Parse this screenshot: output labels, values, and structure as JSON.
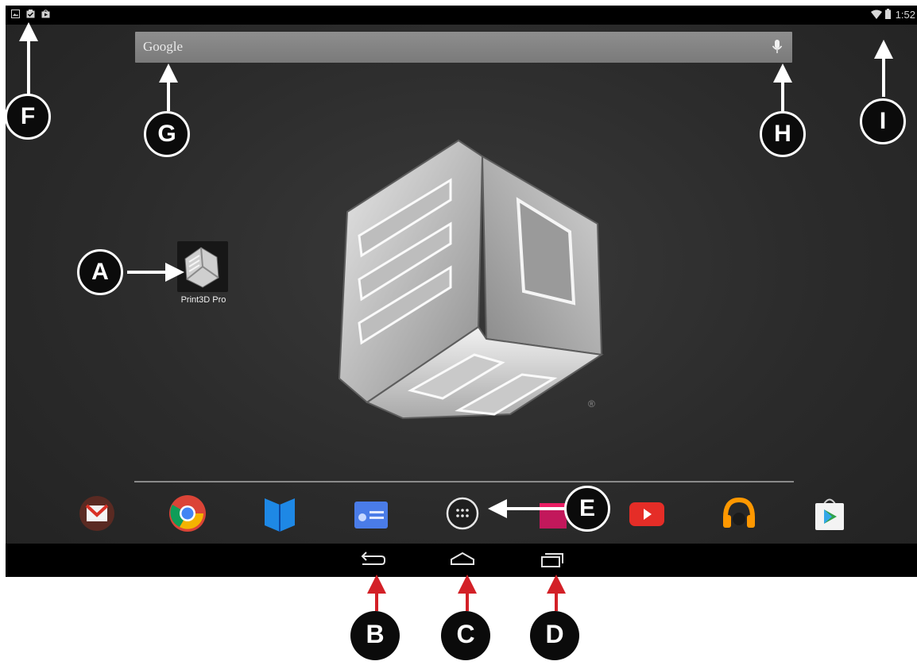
{
  "status_bar": {
    "left_icons": [
      "gallery-icon",
      "clipboard-check-icon",
      "play-store-bag-icon"
    ],
    "right_icons": [
      "wifi-icon",
      "battery-icon"
    ],
    "time": "1:52"
  },
  "search_bar": {
    "text": "Google",
    "mic_icon": "microphone-icon"
  },
  "home_shortcut": {
    "label": "Print3D Pro",
    "icon": "print3d-cube-icon"
  },
  "wallpaper": {
    "logo": "3d-systems-cube-logo",
    "registered_mark": "®"
  },
  "dock": {
    "apps": [
      {
        "name": "Gmail",
        "icon": "gmail-icon"
      },
      {
        "name": "Chrome",
        "icon": "chrome-icon"
      },
      {
        "name": "Play Books",
        "icon": "play-books-icon"
      },
      {
        "name": "News",
        "icon": "news-icon"
      },
      {
        "name": "All Apps",
        "icon": "app-drawer-icon"
      },
      {
        "name": "Play Movies",
        "icon": "play-movies-icon"
      },
      {
        "name": "YouTube",
        "icon": "youtube-icon"
      },
      {
        "name": "Play Music",
        "icon": "play-music-icon"
      },
      {
        "name": "Play Store",
        "icon": "play-store-icon"
      }
    ]
  },
  "nav_bar": {
    "buttons": [
      "back-icon",
      "home-icon",
      "recents-icon"
    ]
  },
  "callouts": [
    "A",
    "B",
    "C",
    "D",
    "E",
    "F",
    "G",
    "H",
    "I"
  ],
  "colors": {
    "callout_arrow_white": "#ffffff",
    "callout_arrow_red": "#d32027",
    "callout_fill": "#0b0b0b"
  }
}
